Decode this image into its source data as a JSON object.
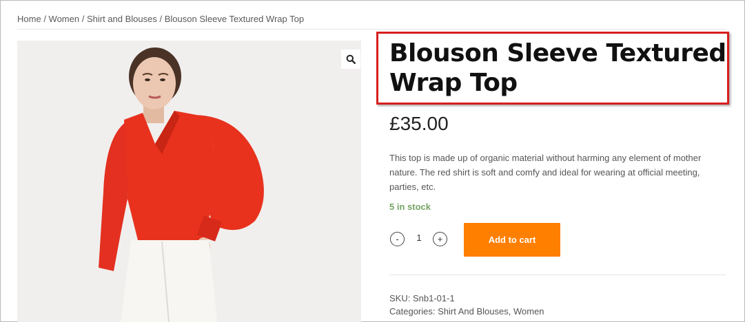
{
  "breadcrumb": {
    "items": [
      "Home",
      "Women",
      "Shirt and Blouses",
      "Blouson Sleeve Textured Wrap Top"
    ],
    "separator": "/"
  },
  "product": {
    "title": "Blouson Sleeve Textured Wrap Top",
    "price": "£35.00",
    "description": "This top is made up of organic material without harming any element of mother nature. The red shirt is soft and comfy and ideal for wearing at official meeting, parties, etc.",
    "stock": "5 in stock",
    "quantity": "1",
    "qty_minus": "-",
    "qty_plus": "+",
    "add_to_cart_label": "Add to cart",
    "sku_label": "SKU:",
    "sku_value": "Snb1-01-1",
    "categories_label": "Categories:",
    "categories": [
      "Shirt And Blouses",
      "Women"
    ],
    "categories_separator": ","
  },
  "icons": {
    "zoom": "magnifier-icon"
  },
  "colors": {
    "accent": "#ff7f00",
    "stock": "#77a464",
    "highlight_border": "#d81e1e",
    "shirt": "#e8321e"
  }
}
